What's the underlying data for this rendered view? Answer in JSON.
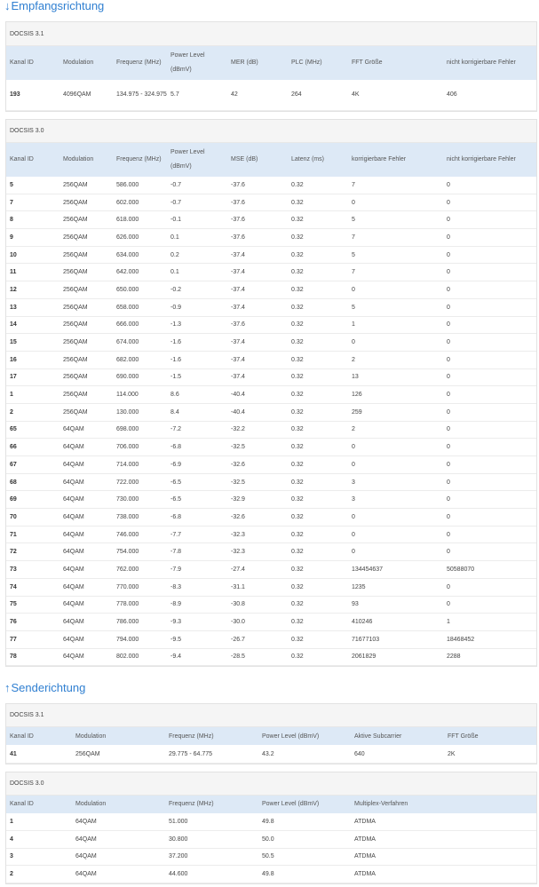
{
  "downstream": {
    "title": "Empfangsrichtung",
    "arrow": "↓",
    "docsis31": {
      "label": "DOCSIS 3.1",
      "headers": [
        "Kanal ID",
        "Modulation",
        "Frequenz (MHz)",
        "Power Level (dBmV)",
        "MER (dB)",
        "PLC (MHz)",
        "FFT Größe",
        "nicht korrigierbare Fehler"
      ],
      "rows": [
        [
          "193",
          "4096QAM",
          "134.975 - 324.975",
          "5.7",
          "42",
          "264",
          "4K",
          "406"
        ]
      ]
    },
    "docsis30": {
      "label": "DOCSIS 3.0",
      "headers": [
        "Kanal ID",
        "Modulation",
        "Frequenz (MHz)",
        "Power Level (dBmV)",
        "MSE (dB)",
        "Latenz (ms)",
        "korrigierbare Fehler",
        "nicht korrigierbare Fehler"
      ],
      "rows": [
        [
          "5",
          "256QAM",
          "586.000",
          "-0.7",
          "-37.6",
          "0.32",
          "7",
          "0"
        ],
        [
          "7",
          "256QAM",
          "602.000",
          "-0.7",
          "-37.6",
          "0.32",
          "0",
          "0"
        ],
        [
          "8",
          "256QAM",
          "618.000",
          "-0.1",
          "-37.6",
          "0.32",
          "5",
          "0"
        ],
        [
          "9",
          "256QAM",
          "626.000",
          "0.1",
          "-37.6",
          "0.32",
          "7",
          "0"
        ],
        [
          "10",
          "256QAM",
          "634.000",
          "0.2",
          "-37.4",
          "0.32",
          "5",
          "0"
        ],
        [
          "11",
          "256QAM",
          "642.000",
          "0.1",
          "-37.4",
          "0.32",
          "7",
          "0"
        ],
        [
          "12",
          "256QAM",
          "650.000",
          "-0.2",
          "-37.4",
          "0.32",
          "0",
          "0"
        ],
        [
          "13",
          "256QAM",
          "658.000",
          "-0.9",
          "-37.4",
          "0.32",
          "5",
          "0"
        ],
        [
          "14",
          "256QAM",
          "666.000",
          "-1.3",
          "-37.6",
          "0.32",
          "1",
          "0"
        ],
        [
          "15",
          "256QAM",
          "674.000",
          "-1.6",
          "-37.4",
          "0.32",
          "0",
          "0"
        ],
        [
          "16",
          "256QAM",
          "682.000",
          "-1.6",
          "-37.4",
          "0.32",
          "2",
          "0"
        ],
        [
          "17",
          "256QAM",
          "690.000",
          "-1.5",
          "-37.4",
          "0.32",
          "13",
          "0"
        ],
        [
          "1",
          "256QAM",
          "114.000",
          "8.6",
          "-40.4",
          "0.32",
          "126",
          "0"
        ],
        [
          "2",
          "256QAM",
          "130.000",
          "8.4",
          "-40.4",
          "0.32",
          "259",
          "0"
        ],
        [
          "65",
          "64QAM",
          "698.000",
          "-7.2",
          "-32.2",
          "0.32",
          "2",
          "0"
        ],
        [
          "66",
          "64QAM",
          "706.000",
          "-6.8",
          "-32.5",
          "0.32",
          "0",
          "0"
        ],
        [
          "67",
          "64QAM",
          "714.000",
          "-6.9",
          "-32.6",
          "0.32",
          "0",
          "0"
        ],
        [
          "68",
          "64QAM",
          "722.000",
          "-6.5",
          "-32.5",
          "0.32",
          "3",
          "0"
        ],
        [
          "69",
          "64QAM",
          "730.000",
          "-6.5",
          "-32.9",
          "0.32",
          "3",
          "0"
        ],
        [
          "70",
          "64QAM",
          "738.000",
          "-6.8",
          "-32.6",
          "0.32",
          "0",
          "0"
        ],
        [
          "71",
          "64QAM",
          "746.000",
          "-7.7",
          "-32.3",
          "0.32",
          "0",
          "0"
        ],
        [
          "72",
          "64QAM",
          "754.000",
          "-7.8",
          "-32.3",
          "0.32",
          "0",
          "0"
        ],
        [
          "73",
          "64QAM",
          "762.000",
          "-7.9",
          "-27.4",
          "0.32",
          "134454637",
          "50588070"
        ],
        [
          "74",
          "64QAM",
          "770.000",
          "-8.3",
          "-31.1",
          "0.32",
          "1235",
          "0"
        ],
        [
          "75",
          "64QAM",
          "778.000",
          "-8.9",
          "-30.8",
          "0.32",
          "93",
          "0"
        ],
        [
          "76",
          "64QAM",
          "786.000",
          "-9.3",
          "-30.0",
          "0.32",
          "410246",
          "1"
        ],
        [
          "77",
          "64QAM",
          "794.000",
          "-9.5",
          "-26.7",
          "0.32",
          "71677103",
          "18468452"
        ],
        [
          "78",
          "64QAM",
          "802.000",
          "-9.4",
          "-28.5",
          "0.32",
          "2061829",
          "2288"
        ]
      ]
    }
  },
  "upstream": {
    "title": "Senderichtung",
    "arrow": "↑",
    "docsis31": {
      "label": "DOCSIS 3.1",
      "headers": [
        "Kanal ID",
        "Modulation",
        "Frequenz (MHz)",
        "Power Level (dBmV)",
        "Aktive Subcarrier",
        "FFT Größe"
      ],
      "rows": [
        [
          "41",
          "256QAM",
          "29.775 - 64.775",
          "43.2",
          "640",
          "2K"
        ]
      ]
    },
    "docsis30": {
      "label": "DOCSIS 3.0",
      "headers": [
        "Kanal ID",
        "Modulation",
        "Frequenz (MHz)",
        "Power Level (dBmV)",
        "Multiplex-Verfahren"
      ],
      "rows": [
        [
          "1",
          "64QAM",
          "51.000",
          "49.8",
          "ATDMA"
        ],
        [
          "4",
          "64QAM",
          "30.800",
          "50.0",
          "ATDMA"
        ],
        [
          "3",
          "64QAM",
          "37.200",
          "50.5",
          "ATDMA"
        ],
        [
          "2",
          "64QAM",
          "44.600",
          "49.8",
          "ATDMA"
        ]
      ]
    }
  }
}
